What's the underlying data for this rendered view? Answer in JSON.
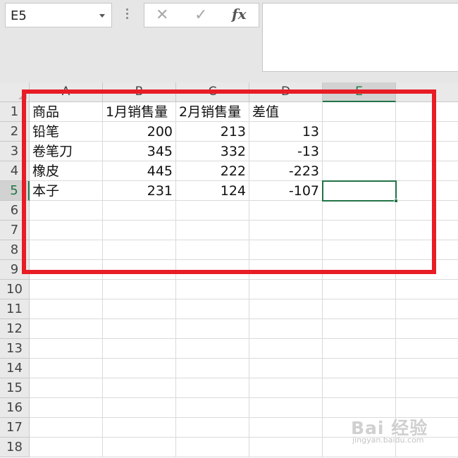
{
  "name_box": {
    "value": "E5"
  },
  "formula_bar": {
    "cancel_symbol": "✕",
    "enter_symbol": "✓",
    "fx_label": "fx",
    "content": ""
  },
  "columns": [
    "A",
    "B",
    "C",
    "D",
    "E"
  ],
  "rows": [
    "1",
    "2",
    "3",
    "4",
    "5",
    "6",
    "7",
    "8",
    "9",
    "10",
    "11",
    "12",
    "13",
    "14",
    "15",
    "16",
    "17",
    "18"
  ],
  "selected_cell": {
    "column": "E",
    "row": "5"
  },
  "cells": [
    {
      "ref": "A1",
      "value": "商品",
      "type": "text"
    },
    {
      "ref": "B1",
      "value": "1月销售量",
      "type": "text"
    },
    {
      "ref": "C1",
      "value": "2月销售量",
      "type": "text"
    },
    {
      "ref": "D1",
      "value": "差值",
      "type": "text"
    },
    {
      "ref": "A2",
      "value": "铅笔",
      "type": "text"
    },
    {
      "ref": "B2",
      "value": "200",
      "type": "number"
    },
    {
      "ref": "C2",
      "value": "213",
      "type": "number"
    },
    {
      "ref": "D2",
      "value": "13",
      "type": "number"
    },
    {
      "ref": "A3",
      "value": "卷笔刀",
      "type": "text"
    },
    {
      "ref": "B3",
      "value": "345",
      "type": "number"
    },
    {
      "ref": "C3",
      "value": "332",
      "type": "number"
    },
    {
      "ref": "D3",
      "value": "-13",
      "type": "number"
    },
    {
      "ref": "A4",
      "value": "橡皮",
      "type": "text"
    },
    {
      "ref": "B4",
      "value": "445",
      "type": "number"
    },
    {
      "ref": "C4",
      "value": "222",
      "type": "number"
    },
    {
      "ref": "D4",
      "value": "-223",
      "type": "number"
    },
    {
      "ref": "A5",
      "value": "本子",
      "type": "text"
    },
    {
      "ref": "B5",
      "value": "231",
      "type": "number"
    },
    {
      "ref": "C5",
      "value": "124",
      "type": "number"
    },
    {
      "ref": "D5",
      "value": "-107",
      "type": "number"
    }
  ],
  "annotation": {
    "color": "#e81c24"
  },
  "accent_color": "#217346",
  "watermark": {
    "line1": "Bai 经验",
    "line2": "jingyan.baidu.com"
  }
}
